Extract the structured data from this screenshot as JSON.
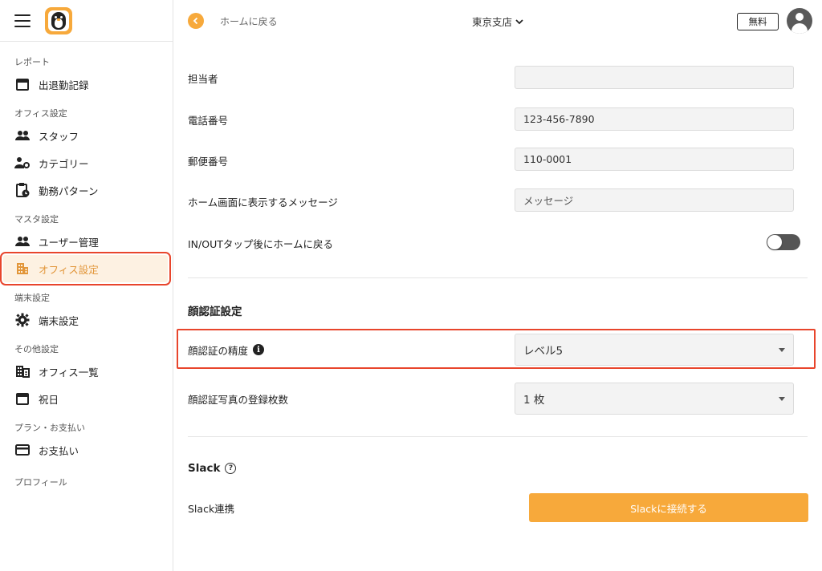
{
  "sidebar": {
    "sections": [
      {
        "title": "レポート",
        "items": [
          {
            "label": "出退勤記録",
            "icon": "calendar-icon"
          }
        ]
      },
      {
        "title": "オフィス設定",
        "items": [
          {
            "label": "スタッフ",
            "icon": "people-icon"
          },
          {
            "label": "カテゴリー",
            "icon": "user-settings-icon"
          },
          {
            "label": "勤務パターン",
            "icon": "clipboard-clock-icon"
          }
        ]
      },
      {
        "title": "マスタ設定",
        "items": [
          {
            "label": "ユーザー管理",
            "icon": "people-icon"
          },
          {
            "label": "オフィス設定",
            "icon": "building-icon",
            "active": true
          }
        ]
      },
      {
        "title": "端末設定",
        "items": [
          {
            "label": "端末設定",
            "icon": "gear-icon"
          }
        ]
      },
      {
        "title": "その他設定",
        "items": [
          {
            "label": "オフィス一覧",
            "icon": "office-list-icon"
          },
          {
            "label": "祝日",
            "icon": "calendar-icon"
          }
        ]
      },
      {
        "title": "プラン・お支払い",
        "items": [
          {
            "label": "お支払い",
            "icon": "credit-card-icon"
          }
        ]
      },
      {
        "title": "プロフィール",
        "items": []
      }
    ]
  },
  "header": {
    "back_label": "ホームに戻る",
    "branch": "東京支店",
    "plan_label": "無料"
  },
  "form": {
    "staff_label": "担当者",
    "staff_value": "",
    "phone_label": "電話番号",
    "phone_value": "123-456-7890",
    "postal_label": "郵便番号",
    "postal_value": "110-0001",
    "message_label": "ホーム画面に表示するメッセージ",
    "message_value": "メッセージ",
    "return_home_label": "IN/OUTタップ後にホームに戻る",
    "return_home_enabled": false
  },
  "face": {
    "section_title": "顔認証設定",
    "accuracy_label": "顔認証の精度",
    "accuracy_value": "レベル5",
    "photo_count_label": "顔認証写真の登録枚数",
    "photo_count_value": "1 枚"
  },
  "slack": {
    "section_title": "Slack",
    "integration_label": "Slack連携",
    "connect_button": "Slackに接続する"
  },
  "colors": {
    "accent": "#f7a93b",
    "highlight": "#e8452c",
    "active_bg": "#fdf1e2"
  }
}
